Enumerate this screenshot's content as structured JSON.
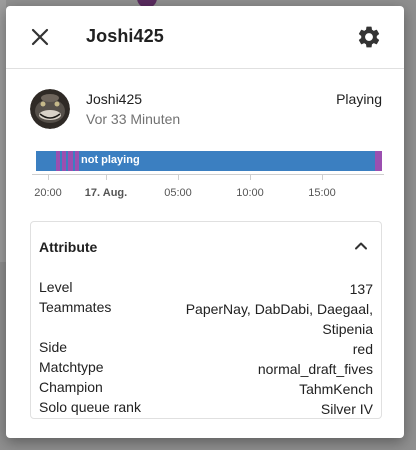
{
  "dialog": {
    "title": "Joshi425",
    "close_icon": "close-icon",
    "settings_icon": "gear-icon"
  },
  "entity": {
    "name": "Joshi425",
    "last_changed": "Vor 33 Minuten",
    "state": "Playing"
  },
  "history": {
    "bar_label": "not playing",
    "colors": {
      "not_playing": "#3b7fc1",
      "playing": "#9b4fb0"
    },
    "ticks": [
      "20:00",
      "17. Aug.",
      "05:00",
      "10:00",
      "15:00"
    ]
  },
  "attributes": {
    "title": "Attribute",
    "collapse_icon": "chevron-up-icon",
    "rows": [
      {
        "key": "Level",
        "value": "137"
      },
      {
        "key": "Teammates",
        "value": "PaperNay, DabDabi, Daegaal, Stipenia"
      },
      {
        "key": "Side",
        "value": "red"
      },
      {
        "key": "Matchtype",
        "value": "normal_draft_fives"
      },
      {
        "key": "Champion",
        "value": "TahmKench"
      },
      {
        "key": "Solo queue rank",
        "value": "Silver IV"
      }
    ]
  }
}
